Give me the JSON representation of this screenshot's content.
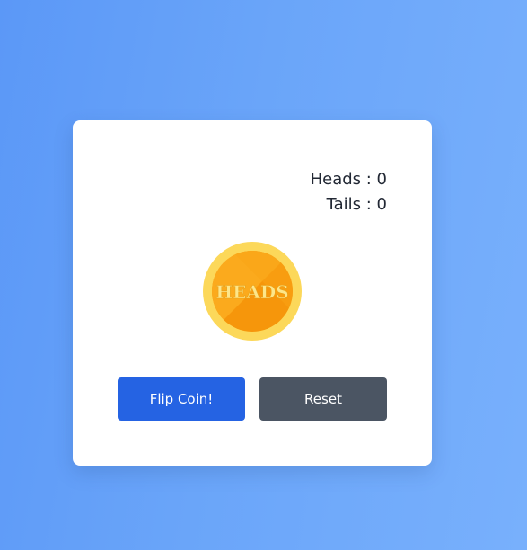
{
  "scoreboard": {
    "heads_text": "Heads : 0",
    "tails_text": "Tails : 0",
    "heads_count": 0,
    "tails_count": 0
  },
  "coin": {
    "face_label": "HEADS",
    "colors": {
      "rim": "#fcd85a",
      "face": "#fbaa1d",
      "face_shade": "#f6960b",
      "text": "#fde68a"
    }
  },
  "controls": {
    "flip_label": "Flip Coin!",
    "reset_label": "Reset",
    "flip_color": "#2563e3",
    "reset_color": "#4b5563"
  }
}
